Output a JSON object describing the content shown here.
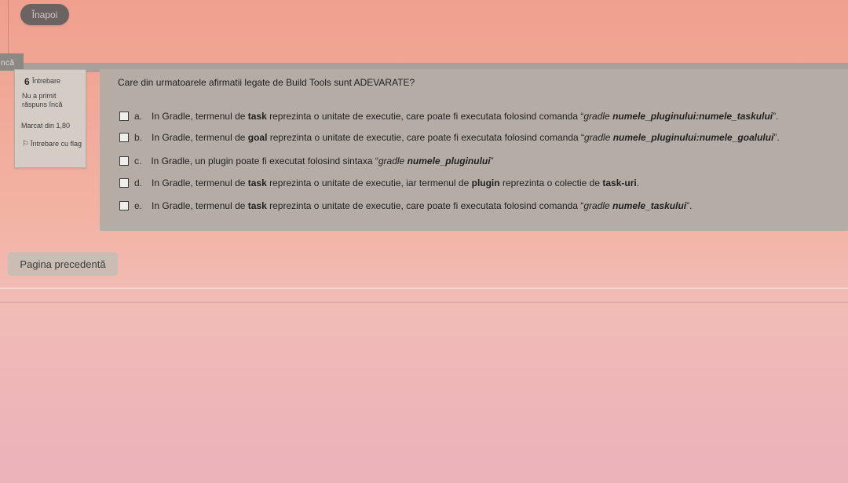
{
  "nav": {
    "back_label": "Înapoi",
    "section_label": "ncă"
  },
  "question_info": {
    "number": "6",
    "label": "Întrebare",
    "state": "Nu a primit răspuns încă",
    "grade": "Marcat din 1,80",
    "flag_label": "Întrebare cu flag",
    "flag_icon": "flag-icon"
  },
  "question": {
    "text": "Care din urmatoarele afirmatii legate de Build Tools sunt ADEVARATE?",
    "answers": [
      {
        "letter": "a.",
        "checked": false,
        "parts": [
          {
            "text": "In Gradle, termenul de ",
            "style": "normal"
          },
          {
            "text": "task",
            "style": "bold"
          },
          {
            "text": " reprezinta o unitate de executie, care poate fi executata folosind comanda “",
            "style": "normal"
          },
          {
            "text": "gradle ",
            "style": "italic"
          },
          {
            "text": "numele_pluginului:numele_taskului",
            "style": "bolditalic"
          },
          {
            "text": "”.",
            "style": "normal"
          }
        ]
      },
      {
        "letter": "b.",
        "checked": false,
        "parts": [
          {
            "text": "In Gradle, termenul de ",
            "style": "normal"
          },
          {
            "text": "goal",
            "style": "bold"
          },
          {
            "text": " reprezinta o unitate de executie, care poate fi executata folosind comanda “",
            "style": "normal"
          },
          {
            "text": "gradle ",
            "style": "italic"
          },
          {
            "text": "numele_pluginului:numele_goalului",
            "style": "bolditalic"
          },
          {
            "text": "”.",
            "style": "normal"
          }
        ]
      },
      {
        "letter": "c.",
        "checked": false,
        "parts": [
          {
            "text": "In Gradle, un plugin poate fi executat folosind sintaxa “",
            "style": "normal"
          },
          {
            "text": "gradle ",
            "style": "italic"
          },
          {
            "text": "numele_pluginului",
            "style": "bolditalic"
          },
          {
            "text": "”",
            "style": "normal"
          }
        ]
      },
      {
        "letter": "d.",
        "checked": false,
        "parts": [
          {
            "text": "In Gradle, termenul de ",
            "style": "normal"
          },
          {
            "text": "task",
            "style": "bold"
          },
          {
            "text": " reprezinta o unitate de executie, iar termenul de ",
            "style": "normal"
          },
          {
            "text": "plugin",
            "style": "bold"
          },
          {
            "text": " reprezinta o colectie de ",
            "style": "normal"
          },
          {
            "text": "task-uri",
            "style": "bold"
          },
          {
            "text": ".",
            "style": "normal"
          }
        ]
      },
      {
        "letter": "e.",
        "checked": false,
        "parts": [
          {
            "text": "In Gradle, termenul de ",
            "style": "normal"
          },
          {
            "text": "task",
            "style": "bold"
          },
          {
            "text": " reprezinta o unitate de executie, care poate fi executata folosind comanda “",
            "style": "normal"
          },
          {
            "text": "gradle ",
            "style": "italic"
          },
          {
            "text": "numele_taskului",
            "style": "bolditalic"
          },
          {
            "text": "”.",
            "style": "normal"
          }
        ]
      }
    ]
  },
  "footer": {
    "prev_label": "Pagina precedentă"
  }
}
